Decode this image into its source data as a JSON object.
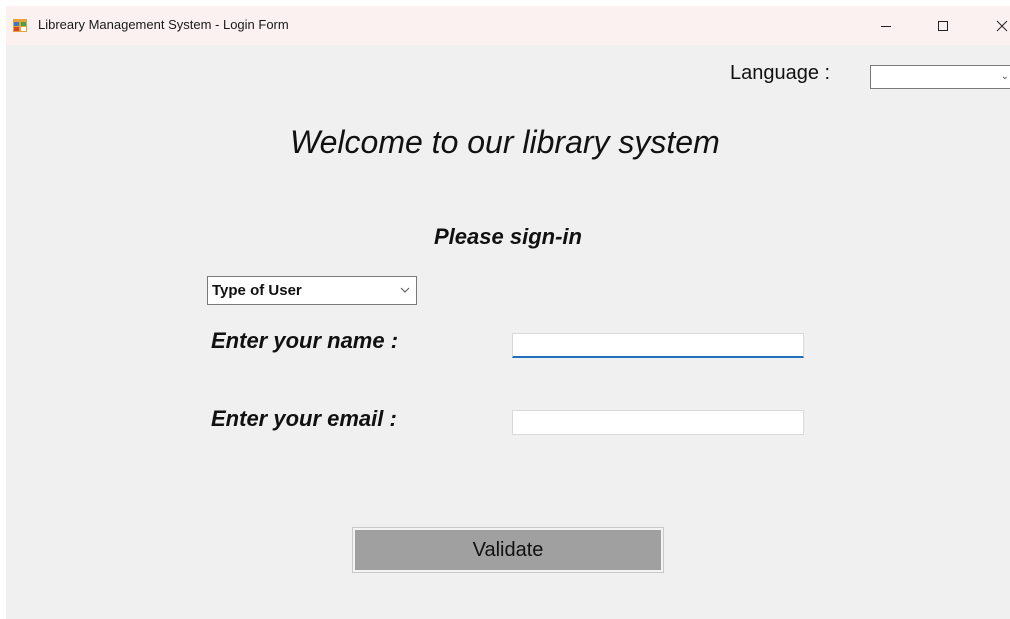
{
  "window": {
    "title": "Libreary Management System - Login Form",
    "icon": "windows-form-icon",
    "controls": [
      "minimize-icon",
      "maximize-icon",
      "close-icon"
    ]
  },
  "language": {
    "label": "Language :",
    "selected": ""
  },
  "main": {
    "welcome": "Welcome to our library system",
    "signin": "Please sign-in"
  },
  "user_type": {
    "selected": "Type of User"
  },
  "form": {
    "name_label": "Enter your name :",
    "name_value": "",
    "email_label": "Enter your email :",
    "email_value": ""
  },
  "actions": {
    "validate_label": "Validate"
  },
  "colors": {
    "window_bg": "#f0f0f0",
    "titlebar_bg": "#fbf1f1",
    "focus_underline": "#1f6fc0",
    "button_bg": "#a0a0a0"
  }
}
